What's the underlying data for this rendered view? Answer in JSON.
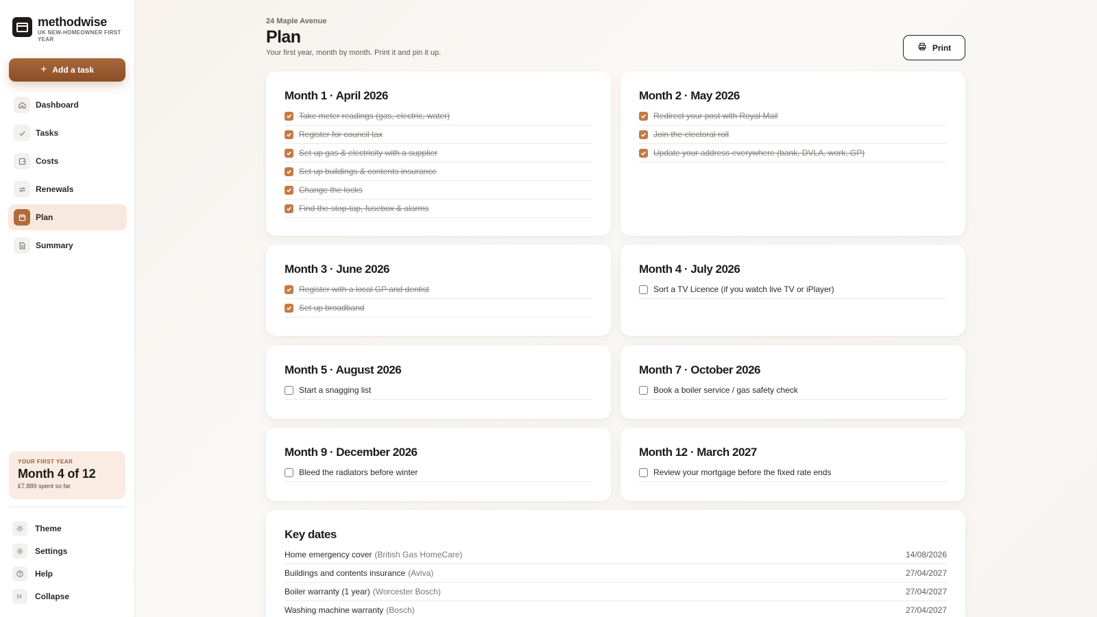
{
  "brand": {
    "name": "methodwise",
    "subtitle": "UK NEW-HOMEOWNER FIRST YEAR"
  },
  "sidebar": {
    "add_task_label": "Add a task",
    "nav": [
      {
        "label": "Dashboard",
        "icon": "home-icon",
        "active": false
      },
      {
        "label": "Tasks",
        "icon": "check-icon",
        "active": false
      },
      {
        "label": "Costs",
        "icon": "wallet-icon",
        "active": false
      },
      {
        "label": "Renewals",
        "icon": "repeat-icon",
        "active": false
      },
      {
        "label": "Plan",
        "icon": "calendar-icon",
        "active": true
      },
      {
        "label": "Summary",
        "icon": "document-icon",
        "active": false
      }
    ],
    "year_card": {
      "label": "YOUR FIRST YEAR",
      "value": "Month 4 of 12",
      "spent": "£7,889 spent so far"
    },
    "footer": [
      {
        "label": "Theme",
        "icon": "sun-icon"
      },
      {
        "label": "Settings",
        "icon": "gear-icon"
      },
      {
        "label": "Help",
        "icon": "help-icon"
      },
      {
        "label": "Collapse",
        "icon": "collapse-icon"
      }
    ]
  },
  "header": {
    "breadcrumb": "24 Maple Avenue",
    "title": "Plan",
    "subtitle": "Your first year, month by month. Print it and pin it up.",
    "print_label": "Print"
  },
  "months": [
    {
      "title": "Month 1 · April 2026",
      "tasks": [
        {
          "text": "Take meter readings (gas, electric, water)",
          "done": true
        },
        {
          "text": "Register for council tax",
          "done": true
        },
        {
          "text": "Set up gas & electricity with a supplier",
          "done": true
        },
        {
          "text": "Set up buildings & contents insurance",
          "done": true
        },
        {
          "text": "Change the locks",
          "done": true
        },
        {
          "text": "Find the stop-tap, fusebox & alarms",
          "done": true
        }
      ]
    },
    {
      "title": "Month 2 · May 2026",
      "tasks": [
        {
          "text": "Redirect your post with Royal Mail",
          "done": true
        },
        {
          "text": "Join the electoral roll",
          "done": true
        },
        {
          "text": "Update your address everywhere (bank, DVLA, work, GP)",
          "done": true
        }
      ]
    },
    {
      "title": "Month 3 · June 2026",
      "tasks": [
        {
          "text": "Register with a local GP and dentist",
          "done": true
        },
        {
          "text": "Set up broadband",
          "done": true
        }
      ]
    },
    {
      "title": "Month 4 · July 2026",
      "tasks": [
        {
          "text": "Sort a TV Licence (if you watch live TV or iPlayer)",
          "done": false
        }
      ]
    },
    {
      "title": "Month 5 · August 2026",
      "tasks": [
        {
          "text": "Start a snagging list",
          "done": false
        }
      ]
    },
    {
      "title": "Month 7 · October 2026",
      "tasks": [
        {
          "text": "Book a boiler service / gas safety check",
          "done": false
        }
      ]
    },
    {
      "title": "Month 9 · December 2026",
      "tasks": [
        {
          "text": "Bleed the radiators before winter",
          "done": false
        }
      ]
    },
    {
      "title": "Month 12 · March 2027",
      "tasks": [
        {
          "text": "Review your mortgage before the fixed rate ends",
          "done": false
        }
      ]
    }
  ],
  "key_dates": {
    "title": "Key dates",
    "items": [
      {
        "name": "Home emergency cover",
        "provider": "(British Gas HomeCare)",
        "date": "14/08/2026"
      },
      {
        "name": "Buildings and contents insurance",
        "provider": "(Aviva)",
        "date": "27/04/2027"
      },
      {
        "name": "Boiler warranty (1 year)",
        "provider": "(Worcester Bosch)",
        "date": "27/04/2027"
      },
      {
        "name": "Washing machine warranty",
        "provider": "(Bosch)",
        "date": "27/04/2027"
      }
    ]
  },
  "colors": {
    "accent": "#b06a3c",
    "check": "#c47b45",
    "active_nav_bg": "#f8e9df"
  }
}
